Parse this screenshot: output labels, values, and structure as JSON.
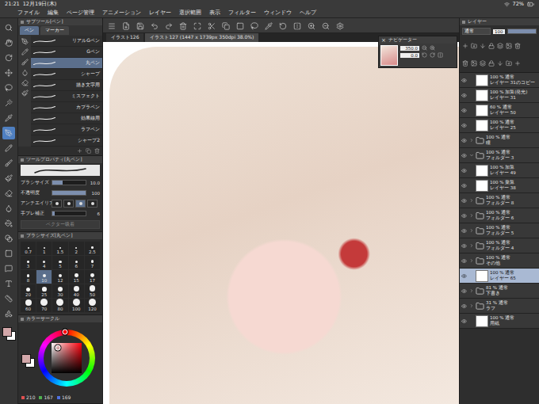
{
  "status_bar": {
    "time": "21:21",
    "date": "12月19日(木)",
    "battery": "72%"
  },
  "menu": [
    "ファイル",
    "編集",
    "ページ管理",
    "アニメーション",
    "レイヤー",
    "選択範囲",
    "表示",
    "フィルター",
    "ウィンドウ",
    "ヘルプ"
  ],
  "tools": [
    {
      "selected": false
    },
    {
      "selected": false
    },
    {
      "selected": false
    },
    {
      "selected": false
    },
    {
      "selected": false
    },
    {
      "selected": false
    },
    {
      "selected": false
    },
    {
      "selected": true
    },
    {
      "selected": false
    },
    {
      "selected": false
    },
    {
      "selected": false
    },
    {
      "selected": false
    },
    {
      "selected": false
    },
    {
      "selected": false
    },
    {
      "selected": false
    },
    {
      "selected": false
    },
    {
      "selected": false
    },
    {
      "selected": false
    },
    {
      "selected": false
    },
    {
      "selected": false
    }
  ],
  "document_tabs": [
    {
      "label": "イラスト126",
      "selected": false
    },
    {
      "label": "イラスト127 (1447 x 1739px 350dpi 38.0%)",
      "selected": true
    }
  ],
  "sub_tool": {
    "title": "サブツール[ペン]",
    "tabs": [
      {
        "label": "ペン",
        "selected": true
      },
      {
        "label": "マーカー",
        "selected": false
      }
    ],
    "items": [
      {
        "label": "リアルGペン",
        "selected": false
      },
      {
        "label": "Gペン",
        "selected": false
      },
      {
        "label": "丸ペン",
        "selected": true
      },
      {
        "label": "シャープ",
        "selected": false
      },
      {
        "label": "描き文字用",
        "selected": false
      },
      {
        "label": "ミスフェクト",
        "selected": false
      },
      {
        "label": "カブラペン",
        "selected": false
      },
      {
        "label": "効果線用",
        "selected": false
      },
      {
        "label": "ラフペン",
        "selected": false
      },
      {
        "label": "シャープ2",
        "selected": false
      }
    ]
  },
  "tool_property": {
    "title": "ツールプロパティ[丸ペン]",
    "rows": [
      {
        "kind": "slider",
        "label": "ブラシサイズ",
        "value": "10.0",
        "level": 0.3
      },
      {
        "kind": "slider",
        "label": "不透明度",
        "value": "100",
        "level": 1
      },
      {
        "kind": "options",
        "label": "アンチエイリアス",
        "options": [
          {
            "selected": false
          },
          {
            "selected": false
          },
          {
            "selected": true
          },
          {
            "selected": false
          }
        ]
      },
      {
        "kind": "slider",
        "label": "手ブレ補正",
        "value": "6",
        "level": 0.06
      }
    ],
    "button": "ベクター吸着"
  },
  "brush_size": {
    "title": "ブラシサイズ[丸ペン]",
    "sizes": [
      {
        "label": "0.7",
        "selected": false
      },
      {
        "label": "1",
        "selected": false
      },
      {
        "label": "1.5",
        "selected": false
      },
      {
        "label": "2",
        "selected": false
      },
      {
        "label": "2.5",
        "selected": false
      },
      {
        "label": "3",
        "selected": false
      },
      {
        "label": "4",
        "selected": false
      },
      {
        "label": "5",
        "selected": false
      },
      {
        "label": "6",
        "selected": false
      },
      {
        "label": "7",
        "selected": false
      },
      {
        "label": "8",
        "selected": false
      },
      {
        "label": "10",
        "selected": true
      },
      {
        "label": "12",
        "selected": false
      },
      {
        "label": "15",
        "selected": false
      },
      {
        "label": "17",
        "selected": false
      },
      {
        "label": "20",
        "selected": false
      },
      {
        "label": "25",
        "selected": false
      },
      {
        "label": "30",
        "selected": false
      },
      {
        "label": "40",
        "selected": false
      },
      {
        "label": "50",
        "selected": false
      },
      {
        "label": "60",
        "selected": false
      },
      {
        "label": "70",
        "selected": false
      },
      {
        "label": "80",
        "selected": false
      },
      {
        "label": "100",
        "selected": false
      },
      {
        "label": "120",
        "selected": false
      }
    ]
  },
  "color_circle": {
    "title": "カラーサークル",
    "color": "#d2a7a9",
    "background_color": "#ffffff",
    "values": [
      {
        "label": "210",
        "color": "#e05050"
      },
      {
        "label": "167",
        "color": "#50b050"
      },
      {
        "label": "169",
        "color": "#5070e0"
      }
    ]
  },
  "navigator": {
    "title": "ナビゲーター",
    "close": "×",
    "zoom": "350.0",
    "angle": "0.0"
  },
  "layers": {
    "title": "レイヤー",
    "blend": "通常",
    "opacity": "100",
    "items": [
      {
        "kind": "layer",
        "mode": "100 % 通常",
        "name": "レイヤー 31のコピー",
        "visible": true,
        "selected": false,
        "expanded": false
      },
      {
        "kind": "layer",
        "mode": "100 % 加算(発光)",
        "name": "レイヤー 31",
        "visible": true,
        "selected": false,
        "expanded": false
      },
      {
        "kind": "layer",
        "mode": "60 % 通常",
        "name": "レイヤー 50",
        "visible": true,
        "selected": false,
        "expanded": false
      },
      {
        "kind": "layer",
        "mode": "100 % 通常",
        "name": "レイヤー 25",
        "visible": true,
        "selected": false,
        "expanded": false
      },
      {
        "kind": "folder",
        "mode": "100 % 通常",
        "name": "瞳",
        "visible": true,
        "selected": false,
        "expanded": false
      },
      {
        "kind": "folder",
        "mode": "100 % 通常",
        "name": "フォルダー 3",
        "visible": true,
        "selected": false,
        "expanded": true
      },
      {
        "kind": "layer",
        "mode": "100 % 加算",
        "name": "レイヤー 49",
        "visible": true,
        "selected": false,
        "expanded": false
      },
      {
        "kind": "layer",
        "mode": "100 % 乗算",
        "name": "レイヤー 38",
        "visible": true,
        "selected": false,
        "expanded": false
      },
      {
        "kind": "folder",
        "mode": "100 % 通常",
        "name": "フォルダー 8",
        "visible": true,
        "selected": false,
        "expanded": false
      },
      {
        "kind": "folder",
        "mode": "100 % 通常",
        "name": "フォルダー 6",
        "visible": true,
        "selected": false,
        "expanded": false
      },
      {
        "kind": "folder",
        "mode": "100 % 通常",
        "name": "フォルダー 5",
        "visible": true,
        "selected": false,
        "expanded": false
      },
      {
        "kind": "folder",
        "mode": "100 % 通常",
        "name": "フォルダー 4",
        "visible": true,
        "selected": false,
        "expanded": false
      },
      {
        "kind": "folder",
        "mode": "100 % 通常",
        "name": "その他",
        "visible": true,
        "selected": false,
        "expanded": false
      },
      {
        "kind": "layer",
        "mode": "100 % 通常",
        "name": "レイヤー 65",
        "visible": true,
        "selected": true,
        "expanded": false
      },
      {
        "kind": "folder",
        "mode": "81 % 通常",
        "name": "下書き",
        "visible": true,
        "selected": false,
        "expanded": false
      },
      {
        "kind": "folder",
        "mode": "31 % 通常",
        "name": "ラフ",
        "visible": true,
        "selected": false,
        "expanded": false
      },
      {
        "kind": "paper",
        "mode": "100 % 通常",
        "name": "用紙",
        "visible": true,
        "selected": false,
        "expanded": false
      }
    ]
  }
}
